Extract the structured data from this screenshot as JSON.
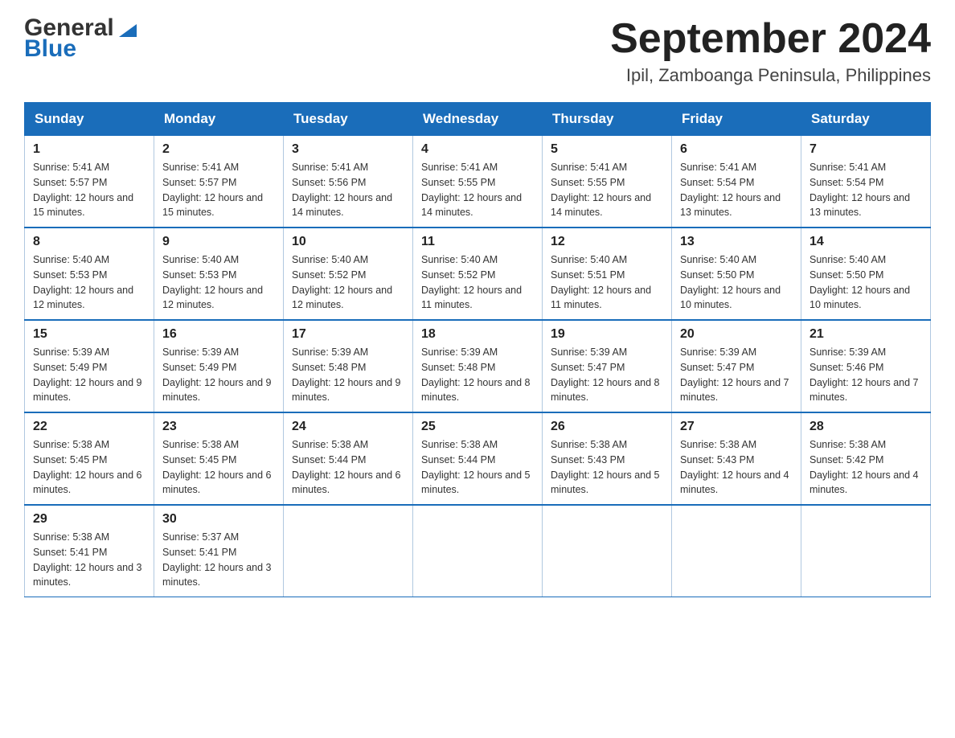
{
  "header": {
    "logo_general": "General",
    "logo_blue": "Blue",
    "month_title": "September 2024",
    "location": "Ipil, Zamboanga Peninsula, Philippines"
  },
  "weekdays": [
    "Sunday",
    "Monday",
    "Tuesday",
    "Wednesday",
    "Thursday",
    "Friday",
    "Saturday"
  ],
  "weeks": [
    [
      {
        "day": "1",
        "sunrise": "5:41 AM",
        "sunset": "5:57 PM",
        "daylight": "12 hours and 15 minutes."
      },
      {
        "day": "2",
        "sunrise": "5:41 AM",
        "sunset": "5:57 PM",
        "daylight": "12 hours and 15 minutes."
      },
      {
        "day": "3",
        "sunrise": "5:41 AM",
        "sunset": "5:56 PM",
        "daylight": "12 hours and 14 minutes."
      },
      {
        "day": "4",
        "sunrise": "5:41 AM",
        "sunset": "5:55 PM",
        "daylight": "12 hours and 14 minutes."
      },
      {
        "day": "5",
        "sunrise": "5:41 AM",
        "sunset": "5:55 PM",
        "daylight": "12 hours and 14 minutes."
      },
      {
        "day": "6",
        "sunrise": "5:41 AM",
        "sunset": "5:54 PM",
        "daylight": "12 hours and 13 minutes."
      },
      {
        "day": "7",
        "sunrise": "5:41 AM",
        "sunset": "5:54 PM",
        "daylight": "12 hours and 13 minutes."
      }
    ],
    [
      {
        "day": "8",
        "sunrise": "5:40 AM",
        "sunset": "5:53 PM",
        "daylight": "12 hours and 12 minutes."
      },
      {
        "day": "9",
        "sunrise": "5:40 AM",
        "sunset": "5:53 PM",
        "daylight": "12 hours and 12 minutes."
      },
      {
        "day": "10",
        "sunrise": "5:40 AM",
        "sunset": "5:52 PM",
        "daylight": "12 hours and 12 minutes."
      },
      {
        "day": "11",
        "sunrise": "5:40 AM",
        "sunset": "5:52 PM",
        "daylight": "12 hours and 11 minutes."
      },
      {
        "day": "12",
        "sunrise": "5:40 AM",
        "sunset": "5:51 PM",
        "daylight": "12 hours and 11 minutes."
      },
      {
        "day": "13",
        "sunrise": "5:40 AM",
        "sunset": "5:50 PM",
        "daylight": "12 hours and 10 minutes."
      },
      {
        "day": "14",
        "sunrise": "5:40 AM",
        "sunset": "5:50 PM",
        "daylight": "12 hours and 10 minutes."
      }
    ],
    [
      {
        "day": "15",
        "sunrise": "5:39 AM",
        "sunset": "5:49 PM",
        "daylight": "12 hours and 9 minutes."
      },
      {
        "day": "16",
        "sunrise": "5:39 AM",
        "sunset": "5:49 PM",
        "daylight": "12 hours and 9 minutes."
      },
      {
        "day": "17",
        "sunrise": "5:39 AM",
        "sunset": "5:48 PM",
        "daylight": "12 hours and 9 minutes."
      },
      {
        "day": "18",
        "sunrise": "5:39 AM",
        "sunset": "5:48 PM",
        "daylight": "12 hours and 8 minutes."
      },
      {
        "day": "19",
        "sunrise": "5:39 AM",
        "sunset": "5:47 PM",
        "daylight": "12 hours and 8 minutes."
      },
      {
        "day": "20",
        "sunrise": "5:39 AM",
        "sunset": "5:47 PM",
        "daylight": "12 hours and 7 minutes."
      },
      {
        "day": "21",
        "sunrise": "5:39 AM",
        "sunset": "5:46 PM",
        "daylight": "12 hours and 7 minutes."
      }
    ],
    [
      {
        "day": "22",
        "sunrise": "5:38 AM",
        "sunset": "5:45 PM",
        "daylight": "12 hours and 6 minutes."
      },
      {
        "day": "23",
        "sunrise": "5:38 AM",
        "sunset": "5:45 PM",
        "daylight": "12 hours and 6 minutes."
      },
      {
        "day": "24",
        "sunrise": "5:38 AM",
        "sunset": "5:44 PM",
        "daylight": "12 hours and 6 minutes."
      },
      {
        "day": "25",
        "sunrise": "5:38 AM",
        "sunset": "5:44 PM",
        "daylight": "12 hours and 5 minutes."
      },
      {
        "day": "26",
        "sunrise": "5:38 AM",
        "sunset": "5:43 PM",
        "daylight": "12 hours and 5 minutes."
      },
      {
        "day": "27",
        "sunrise": "5:38 AM",
        "sunset": "5:43 PM",
        "daylight": "12 hours and 4 minutes."
      },
      {
        "day": "28",
        "sunrise": "5:38 AM",
        "sunset": "5:42 PM",
        "daylight": "12 hours and 4 minutes."
      }
    ],
    [
      {
        "day": "29",
        "sunrise": "5:38 AM",
        "sunset": "5:41 PM",
        "daylight": "12 hours and 3 minutes."
      },
      {
        "day": "30",
        "sunrise": "5:37 AM",
        "sunset": "5:41 PM",
        "daylight": "12 hours and 3 minutes."
      },
      null,
      null,
      null,
      null,
      null
    ]
  ]
}
